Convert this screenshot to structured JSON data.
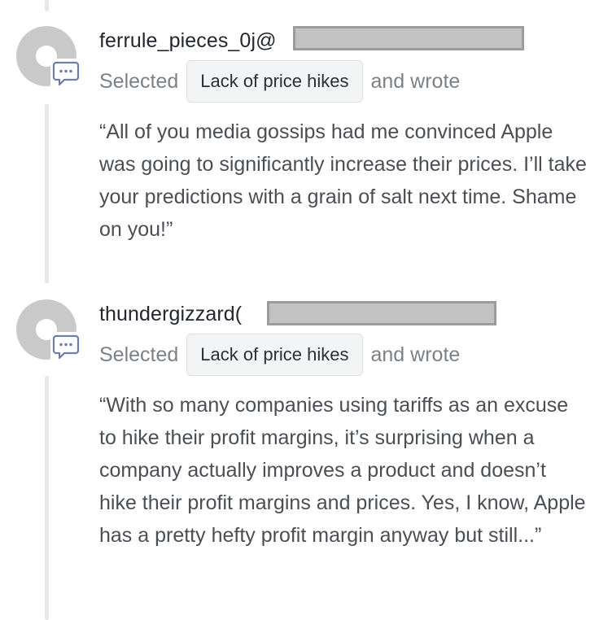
{
  "comments": [
    {
      "username": "ferrule_pieces_0j@",
      "action_prefix": "Selected",
      "chip_label": "Lack of price hikes",
      "action_suffix": "and wrote",
      "quote": "“All of you media gossips had me convinced Apple was going to significantly increase their prices. I’ll take your predictions with a grain of salt next time. Shame on you!”"
    },
    {
      "username": "thundergizzard(",
      "action_prefix": "Selected",
      "chip_label": "Lack of price hikes",
      "action_suffix": "and wrote",
      "quote": "“With so many companies using tariffs as an excuse to hike their profit margins, it’s surprising when a company actually improves a product and doesn’t hike their profit margins and prices. Yes, I know, Apple has a pretty hefty profit margin anyway but still...”"
    }
  ],
  "colors": {
    "avatar_gray": "#c9c9c9",
    "comment_icon_blue": "#6b7fa8",
    "thread_line": "#e6e7e9",
    "redaction_fill": "#c2c2c2"
  },
  "icons": {
    "avatar": "default-avatar-icon",
    "comment_badge": "speech-bubble-icon"
  }
}
